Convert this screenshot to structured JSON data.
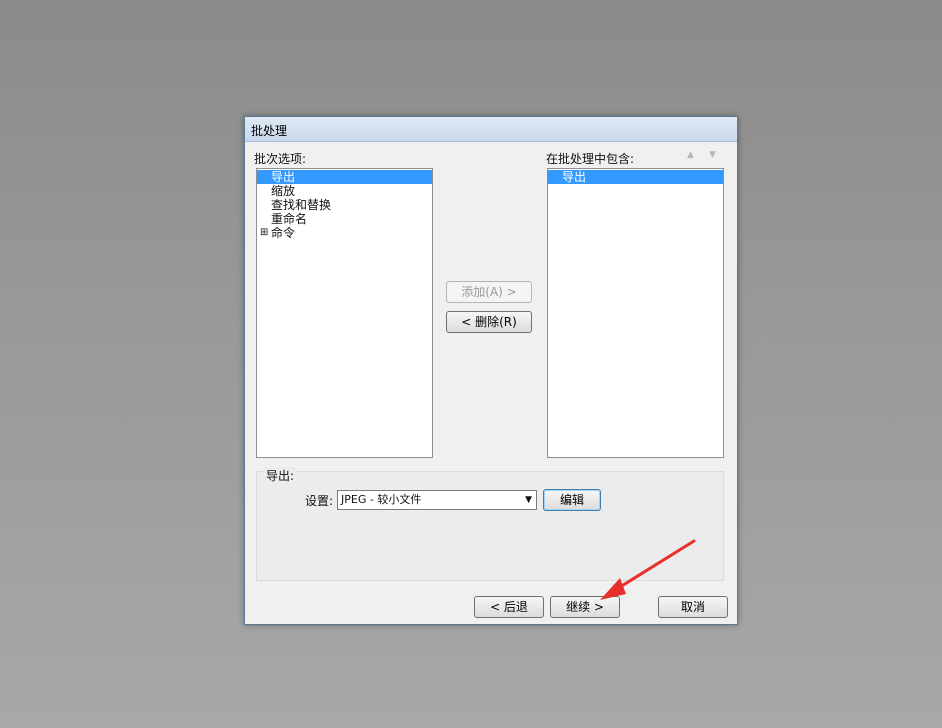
{
  "dialog": {
    "title": "批处理",
    "options_label": "批次选项:",
    "options": [
      {
        "label": "导出",
        "selected": true,
        "expandable": false
      },
      {
        "label": "缩放",
        "selected": false,
        "expandable": false
      },
      {
        "label": "查找和替换",
        "selected": false,
        "expandable": false
      },
      {
        "label": "重命名",
        "selected": false,
        "expandable": false
      },
      {
        "label": "命令",
        "selected": false,
        "expandable": true,
        "expander": "⊞"
      }
    ],
    "included_label": "在批处理中包含:",
    "included": [
      {
        "label": "导出",
        "selected": true
      }
    ],
    "move_up_icon": "▲",
    "move_down_icon": "▼",
    "add_button": "添加(A) >",
    "remove_button": "< 删除(R)",
    "group_label": "导出:",
    "settings_label": "设置:",
    "settings_value": "JPEG - 较小文件",
    "edit_button": "编辑",
    "back_button": "< 后退",
    "continue_button": "继续 >",
    "cancel_button": "取消"
  },
  "colors": {
    "selection": "#3399ff",
    "annotation_arrow": "#e8302a"
  }
}
